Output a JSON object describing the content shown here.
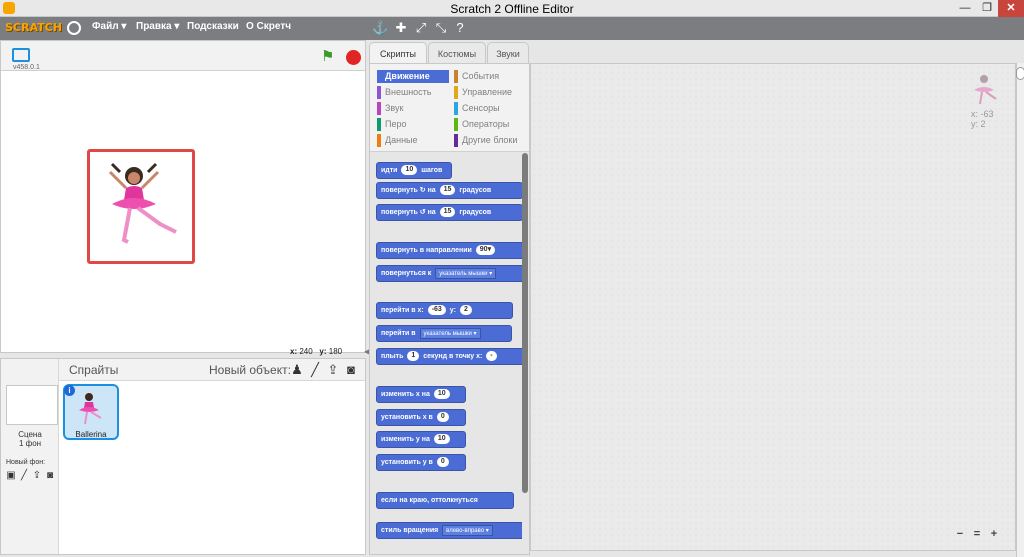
{
  "window": {
    "title": "Scratch 2 Offline Editor",
    "min_label": "—",
    "max_label": "❐",
    "close_label": "✕"
  },
  "menubar": {
    "logo": "SCRATCH",
    "items": [
      "Файл ▾",
      "Правка ▾",
      "Подсказки",
      "О Скретч"
    ],
    "tool_icons": [
      "duplicate-icon",
      "delete-icon",
      "grow-icon",
      "shrink-icon",
      "help-icon"
    ]
  },
  "stage": {
    "version": "v458.0.1",
    "coord_x_label": "x:",
    "coord_x": "240",
    "coord_y_label": "y:",
    "coord_y": "180"
  },
  "sprites": {
    "title": "Спрайты",
    "new_object": "Новый объект:",
    "scene_label": "Сцена",
    "scene_count": "1 фон",
    "new_backdrop": "Новый фон:",
    "sprite_name": "Ballerina",
    "info_glyph": "i"
  },
  "tabs": [
    "Скрипты",
    "Костюмы",
    "Звуки"
  ],
  "categories": {
    "left": [
      {
        "label": "Движение",
        "color": "#4a6cd4"
      },
      {
        "label": "Внешность",
        "color": "#8a55d7"
      },
      {
        "label": "Звук",
        "color": "#bb42c3"
      },
      {
        "label": "Перо",
        "color": "#0e9a6c"
      },
      {
        "label": "Данные",
        "color": "#ee7d16"
      }
    ],
    "right": [
      {
        "label": "События",
        "color": "#c88330"
      },
      {
        "label": "Управление",
        "color": "#e1a91a"
      },
      {
        "label": "Сенсоры",
        "color": "#2ca5e2"
      },
      {
        "label": "Операторы",
        "color": "#5cb712"
      },
      {
        "label": "Другие блоки",
        "color": "#632d99"
      }
    ]
  },
  "blocks": [
    {
      "pre": "идти",
      "field": "10",
      "post": "шагов"
    },
    {
      "pre": "повернуть ↻ на",
      "field": "15",
      "post": "градусов"
    },
    {
      "pre": "повернуть ↺ на",
      "field": "15",
      "post": "градусов"
    },
    {
      "pre": "повернуть в направлении",
      "field": "90▾",
      "post": ""
    },
    {
      "pre": "повернуться к",
      "drop": "указатель мышки ▾",
      "post": ""
    },
    {
      "pre": "перейти в x:",
      "field": "-63",
      "mid": "y:",
      "field2": "2",
      "post": ""
    },
    {
      "pre": "перейти в",
      "drop": "указатель мышки ▾",
      "post": ""
    },
    {
      "pre": "плыть",
      "field": "1",
      "mid": "секунд в точку x:",
      "field2": "-",
      "post": ""
    },
    {
      "pre": "изменить х на",
      "field": "10",
      "post": ""
    },
    {
      "pre": "установить х в",
      "field": "0",
      "post": ""
    },
    {
      "pre": "изменить у на",
      "field": "10",
      "post": ""
    },
    {
      "pre": "установить у в",
      "field": "0",
      "post": ""
    },
    {
      "pre": "если на краю, оттолкнуться",
      "post": ""
    },
    {
      "pre": "стиль вращения",
      "drop": "влево-вправо ▾",
      "post": ""
    }
  ],
  "script_area": {
    "sprite_x": "x: -63",
    "sprite_y": "y: 2",
    "zoom_out": "−",
    "zoom_reset": "=",
    "zoom_in": "+"
  }
}
